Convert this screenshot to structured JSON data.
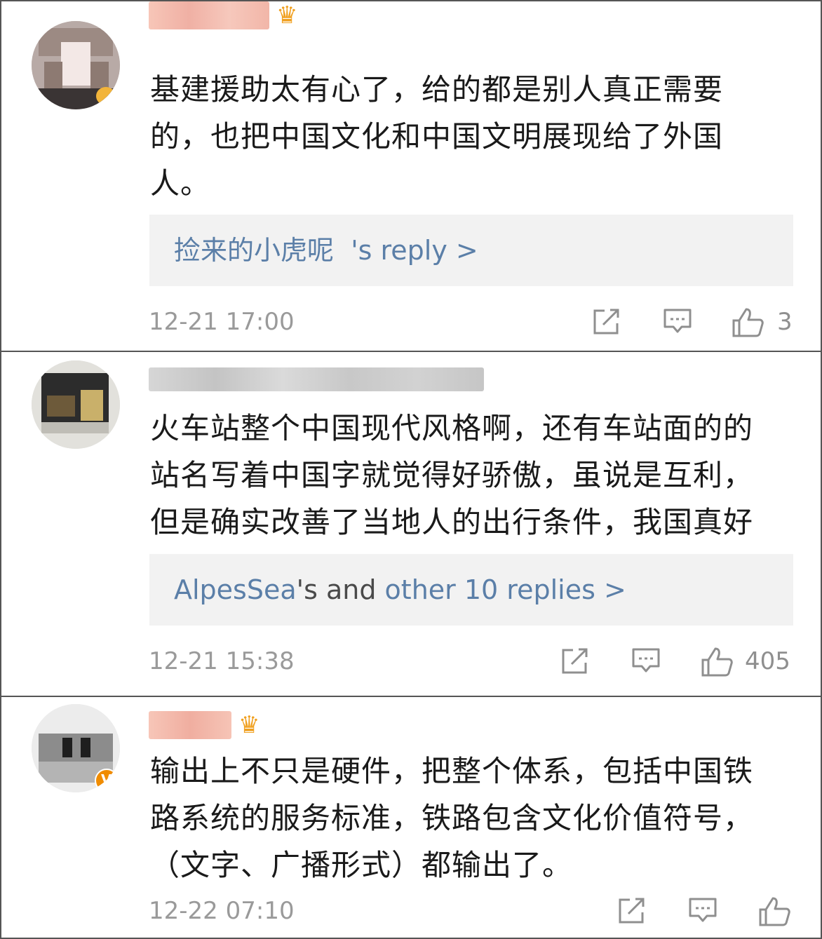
{
  "comments": [
    {
      "text": "基建援助太有心了，给的都是别人真正需要\n的，也把中国文化和中国文明展现给了外国\n人。",
      "reply": {
        "name": "捡来的小虎呢",
        "suffix": "'s reply >"
      },
      "time": "12-21 17:00",
      "likes": "3"
    },
    {
      "text": "火车站整个中国现代风格啊，还有车站面的的\n站名写着中国字就觉得好骄傲，虽说是互利，\n但是确实改善了当地人的出行条件，我国真好",
      "reply": {
        "name": "AlpesSea",
        "suffix": "'s and ",
        "more": "other 10 replies >"
      },
      "time": "12-21 15:38",
      "likes": "405"
    },
    {
      "text": "输出上不只是硬件，把整个体系，包括中国铁\n路系统的服务标准，铁路包含文化价值符号，\n（文字、广播形式）都输出了。",
      "time": "12-22 07:10",
      "likes": ""
    }
  ],
  "icons": [
    "share-icon",
    "comment-icon",
    "like-icon"
  ],
  "colors": {
    "link": "#5b7fa8",
    "meta": "#9a9a9a",
    "reply_bg": "#f2f2f2",
    "crown": "#f0a020",
    "badge": "#f08c00"
  }
}
